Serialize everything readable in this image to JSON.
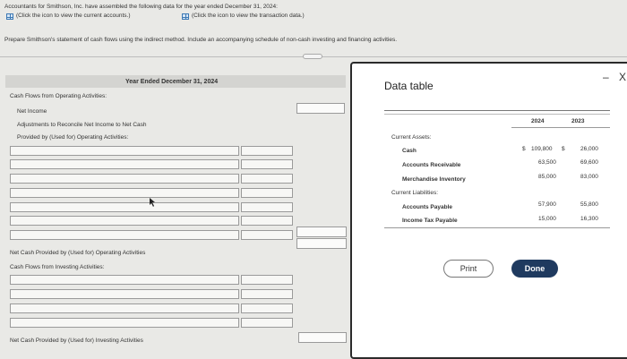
{
  "instructions": {
    "line1": "Accountants for Smithson, Inc. have assembled the following data for the year ended December 31, 2024:",
    "link_accounts": "(Click the icon to view the current accounts.)",
    "link_transactions": "(Click the icon to view the transaction data.)",
    "prompt": "Prepare Smithson's statement of cash flows using the indirect method. Include an accompanying schedule of non-cash investing and financing activities."
  },
  "worksheet": {
    "header": "Year Ended December 31, 2024",
    "operating_title": "Cash Flows from Operating Activities:",
    "net_income": "Net Income",
    "adjustments": "Adjustments to Reconcile Net Income to Net Cash",
    "provided_by": "Provided by (Used for) Operating Activities:",
    "net_operating": "Net Cash Provided by (Used for) Operating Activities",
    "investing_title": "Cash Flows from Investing Activities:",
    "net_investing": "Net Cash Provided by (Used for) Investing Activities"
  },
  "modal": {
    "title": "Data table",
    "col_2024": "2024",
    "col_2023": "2023",
    "section_assets": "Current Assets:",
    "section_liabilities": "Current Liabilities:",
    "rows": [
      {
        "label": "Cash",
        "cur_prefix": "$",
        "v2024": "109,800",
        "mid": "$",
        "v2023": "26,000"
      },
      {
        "label": "Accounts Receivable",
        "cur_prefix": "",
        "v2024": "63,500",
        "mid": "",
        "v2023": "69,600"
      },
      {
        "label": "Merchandise Inventory",
        "cur_prefix": "",
        "v2024": "85,000",
        "mid": "",
        "v2023": "83,000"
      },
      {
        "label": "Accounts Payable",
        "cur_prefix": "",
        "v2024": "57,900",
        "mid": "",
        "v2023": "55,800"
      },
      {
        "label": "Income Tax Payable",
        "cur_prefix": "",
        "v2024": "15,000",
        "mid": "",
        "v2023": "16,300"
      }
    ],
    "print_label": "Print",
    "done_label": "Done",
    "minimize_glyph": "–",
    "close_glyph": "X"
  },
  "colors": {
    "done_button": "#1f3a5f",
    "link_icon": "#3c78b4"
  }
}
